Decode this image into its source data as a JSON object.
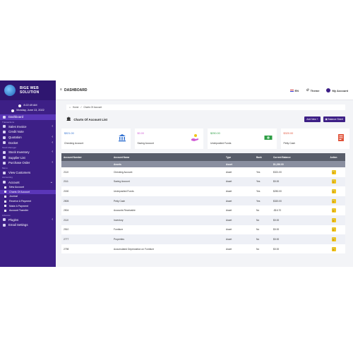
{
  "brand": {
    "line1": "BIGE WEB",
    "line2": "SOLUTION"
  },
  "clock": {
    "time": "8:22:49 AM",
    "date": "Monday, June 13, 2022"
  },
  "sidebar": {
    "items": [
      {
        "type": "item",
        "label": "Dashboard",
        "active": true,
        "chev": false
      },
      {
        "type": "section",
        "label": "Transactions"
      },
      {
        "type": "item",
        "label": "Sales Invoice",
        "chev": true
      },
      {
        "type": "item",
        "label": "Credit Note",
        "chev": false
      },
      {
        "type": "item",
        "label": "Quotation",
        "chev": true
      },
      {
        "type": "item",
        "label": "Docket",
        "chev": true
      },
      {
        "type": "section",
        "label": "Stock Manager"
      },
      {
        "type": "item",
        "label": "Stock Inventory",
        "chev": true
      },
      {
        "type": "item",
        "label": "Supplier List",
        "chev": false
      },
      {
        "type": "item",
        "label": "Purchase Order",
        "chev": true
      },
      {
        "type": "section",
        "label": "Menu"
      },
      {
        "type": "item",
        "label": "View Customers",
        "chev": false
      },
      {
        "type": "section",
        "label": "Accounting"
      },
      {
        "type": "item",
        "label": "Account",
        "chev": true,
        "open": true
      },
      {
        "type": "sub",
        "label": "New Account"
      },
      {
        "type": "sub",
        "label": "Charts Of Account",
        "active": true
      },
      {
        "type": "sub",
        "label": "Journal"
      },
      {
        "type": "sub",
        "label": "Receive A Payment"
      },
      {
        "type": "sub",
        "label": "Make A Payment"
      },
      {
        "type": "sub",
        "label": "Account Transfer"
      },
      {
        "type": "section",
        "label": "Advance"
      },
      {
        "type": "item",
        "label": "Plugins",
        "chev": true
      },
      {
        "type": "item",
        "label": "Email Settings",
        "chev": false
      }
    ]
  },
  "topbar": {
    "title": "DASHBOARD",
    "lang": "EN",
    "theme": "Theme",
    "account": "My Account"
  },
  "breadcrumb": {
    "home": "Home",
    "current": "Charts Of Account"
  },
  "card": {
    "title": "Charts Of Account List",
    "add_label": "Add New",
    "balance_label": "Balance Sheet"
  },
  "stats": [
    {
      "amount": "$321.00",
      "label": "Checking Account",
      "color": "#2f6fd0",
      "icon": "bank-icon"
    },
    {
      "amount": "$0.00",
      "label": "Saving Account",
      "color": "#d05bd6",
      "icon": "hand-coin-icon"
    },
    {
      "amount": "$250.00",
      "label": "Undeposited Funds",
      "color": "#2e9e45",
      "icon": "cash-icon"
    },
    {
      "amount": "$320.00",
      "label": "Petty Cash",
      "color": "#e0533a",
      "icon": "receipt-icon"
    }
  ],
  "table": {
    "headers": [
      "Account Number",
      "Account Name",
      "Type",
      "Bank",
      "Current Balance",
      "Action"
    ],
    "group": {
      "name": "Assets",
      "type": "Asset",
      "balance": "$1,236.00"
    },
    "rows": [
      {
        "number": "2110",
        "name": "Checking Account",
        "type": "Asset",
        "bank": "Yes",
        "balance": "$321.00"
      },
      {
        "number": "2111",
        "name": "Saving Account",
        "type": "Asset",
        "bank": "Yes",
        "balance": "$0.00"
      },
      {
        "number": "2150",
        "name": "Undeposited Funds",
        "type": "Asset",
        "bank": "Yes",
        "balance": "$250.00"
      },
      {
        "number": "2505",
        "name": "Petty Cash",
        "type": "Asset",
        "bank": "Yes",
        "balance": "$320.00"
      },
      {
        "number": "2504",
        "name": "Accounts Receivable",
        "type": "Asset",
        "bank": "No",
        "balance": "-$16.70"
      },
      {
        "number": "2110",
        "name": "Inventory",
        "type": "Asset",
        "bank": "No",
        "balance": "$0.00"
      },
      {
        "number": "2510",
        "name": "Furniture",
        "type": "Asset",
        "bank": "No",
        "balance": "$0.00"
      },
      {
        "number": "2777",
        "name": "Properties",
        "type": "Asset",
        "bank": "No",
        "balance": "$0.00"
      },
      {
        "number": "2798",
        "name": "Accumulated Depreciation on Furniture",
        "type": "Asset",
        "bank": "No",
        "balance": "$0.00"
      }
    ]
  },
  "colors": {
    "sidebar": "#3d1f86",
    "accent": "#3d1f86",
    "action": "#f0c419"
  }
}
